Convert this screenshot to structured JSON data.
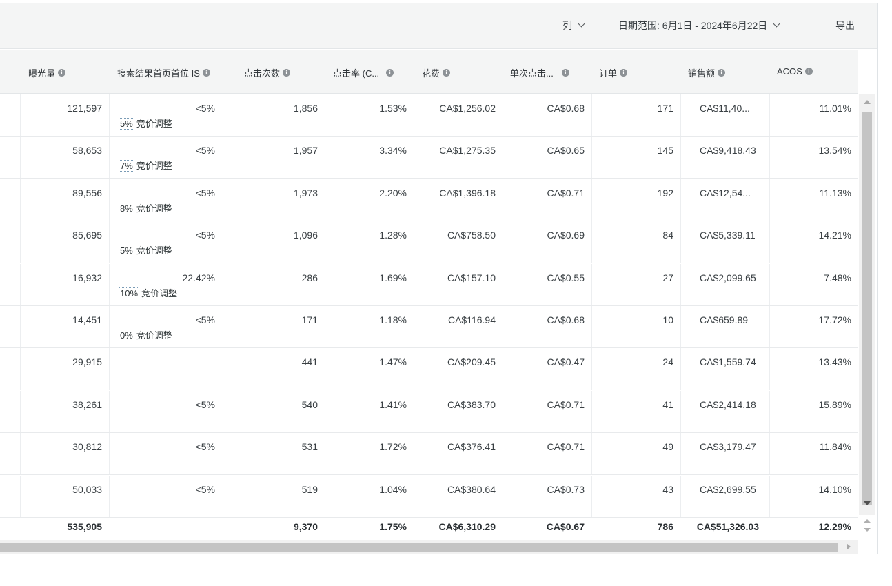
{
  "toolbar": {
    "columns_label": "列",
    "date_range_label": "日期范围: 6月1日 - 2024年6月22日",
    "export_label": "导出"
  },
  "headers": [
    "曝光量",
    "搜索结果首页首位 IS",
    "点击次数",
    "点击率 (C...",
    "花费",
    "单次点击...",
    "订单",
    "销售额",
    "ACOS"
  ],
  "bid_adjust_label": "竞价调整",
  "rows": [
    {
      "impressions": "121,597",
      "top_is": "<5%",
      "bid_pct": "5%",
      "clicks": "1,856",
      "ctr": "1.53%",
      "spend": "CA$1,256.02",
      "cpc": "CA$0.68",
      "orders": "171",
      "sales": "CA$11,40...",
      "acos": "11.01%"
    },
    {
      "impressions": "58,653",
      "top_is": "<5%",
      "bid_pct": "7%",
      "clicks": "1,957",
      "ctr": "3.34%",
      "spend": "CA$1,275.35",
      "cpc": "CA$0.65",
      "orders": "145",
      "sales": "CA$9,418.43",
      "acos": "13.54%"
    },
    {
      "impressions": "89,556",
      "top_is": "<5%",
      "bid_pct": "8%",
      "clicks": "1,973",
      "ctr": "2.20%",
      "spend": "CA$1,396.18",
      "cpc": "CA$0.71",
      "orders": "192",
      "sales": "CA$12,54...",
      "acos": "11.13%"
    },
    {
      "impressions": "85,695",
      "top_is": "<5%",
      "bid_pct": "5%",
      "clicks": "1,096",
      "ctr": "1.28%",
      "spend": "CA$758.50",
      "cpc": "CA$0.69",
      "orders": "84",
      "sales": "CA$5,339.11",
      "acos": "14.21%"
    },
    {
      "impressions": "16,932",
      "top_is": "22.42%",
      "bid_pct": "10%",
      "clicks": "286",
      "ctr": "1.69%",
      "spend": "CA$157.10",
      "cpc": "CA$0.55",
      "orders": "27",
      "sales": "CA$2,099.65",
      "acos": "7.48%"
    },
    {
      "impressions": "14,451",
      "top_is": "<5%",
      "bid_pct": "0%",
      "clicks": "171",
      "ctr": "1.18%",
      "spend": "CA$116.94",
      "cpc": "CA$0.68",
      "orders": "10",
      "sales": "CA$659.89",
      "acos": "17.72%"
    },
    {
      "impressions": "29,915",
      "top_is": "—",
      "bid_pct": "",
      "clicks": "441",
      "ctr": "1.47%",
      "spend": "CA$209.45",
      "cpc": "CA$0.47",
      "orders": "24",
      "sales": "CA$1,559.74",
      "acos": "13.43%"
    },
    {
      "impressions": "38,261",
      "top_is": "<5%",
      "bid_pct": "",
      "clicks": "540",
      "ctr": "1.41%",
      "spend": "CA$383.70",
      "cpc": "CA$0.71",
      "orders": "41",
      "sales": "CA$2,414.18",
      "acos": "15.89%"
    },
    {
      "impressions": "30,812",
      "top_is": "<5%",
      "bid_pct": "",
      "clicks": "531",
      "ctr": "1.72%",
      "spend": "CA$376.41",
      "cpc": "CA$0.71",
      "orders": "49",
      "sales": "CA$3,179.47",
      "acos": "11.84%"
    },
    {
      "impressions": "50,033",
      "top_is": "<5%",
      "bid_pct": "",
      "clicks": "519",
      "ctr": "1.04%",
      "spend": "CA$380.64",
      "cpc": "CA$0.73",
      "orders": "43",
      "sales": "CA$2,699.55",
      "acos": "14.10%"
    }
  ],
  "totals": {
    "impressions": "535,905",
    "top_is": "",
    "clicks": "9,370",
    "ctr": "1.75%",
    "spend": "CA$6,310.29",
    "cpc": "CA$0.67",
    "orders": "786",
    "sales": "CA$51,326.03",
    "acos": "12.29%"
  }
}
